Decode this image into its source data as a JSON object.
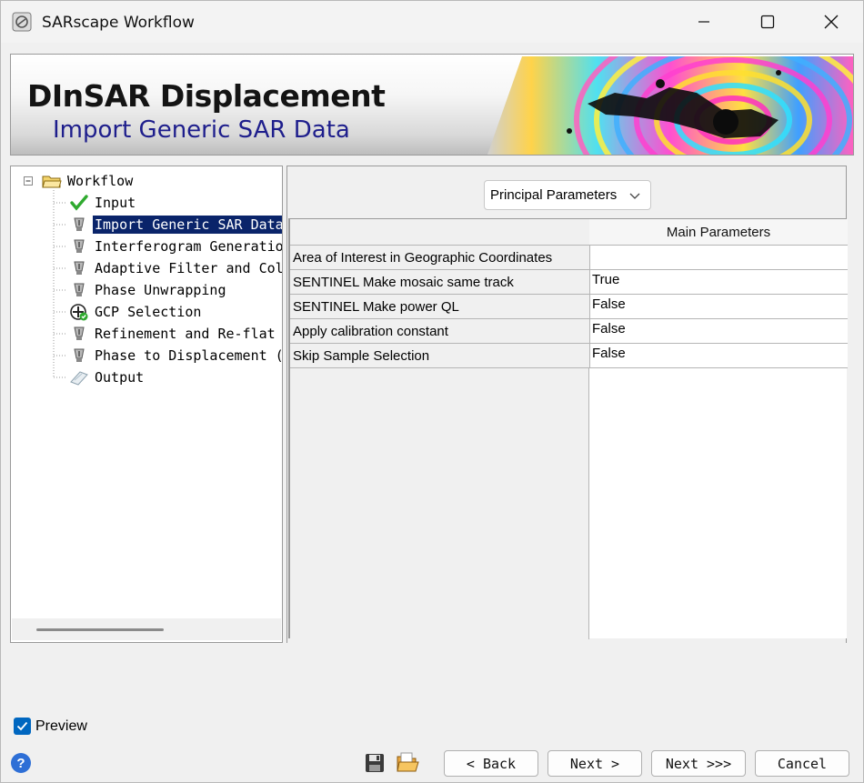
{
  "window": {
    "title": "SARscape Workflow"
  },
  "banner": {
    "title": "DInSAR Displacement",
    "subtitle": "Import Generic SAR Data"
  },
  "tree": {
    "root": "Workflow",
    "items": [
      {
        "label": "Input",
        "icon": "check-icon"
      },
      {
        "label": "Import Generic SAR Data",
        "icon": "tool-icon",
        "selected": true
      },
      {
        "label": "Interferogram Generation",
        "icon": "tool-icon"
      },
      {
        "label": "Adaptive Filter and Col",
        "icon": "tool-icon"
      },
      {
        "label": "Phase Unwrapping",
        "icon": "tool-icon"
      },
      {
        "label": "GCP Selection",
        "icon": "gcp-icon"
      },
      {
        "label": "Refinement and Re-flat",
        "icon": "tool-icon"
      },
      {
        "label": "Phase to Displacement (",
        "icon": "tool-icon"
      },
      {
        "label": "Output",
        "icon": "output-icon"
      }
    ]
  },
  "parameters": {
    "selector": "Principal Parameters",
    "column_header": "Main Parameters",
    "rows": [
      {
        "name": "Area of Interest in Geographic Coordinates",
        "value": ""
      },
      {
        "name": "SENTINEL Make mosaic same track",
        "value": "True"
      },
      {
        "name": "SENTINEL Make power QL",
        "value": "False"
      },
      {
        "name": "Apply calibration constant",
        "value": "False"
      },
      {
        "name": "Skip Sample Selection",
        "value": "False"
      }
    ]
  },
  "footer": {
    "preview_label": "Preview",
    "preview_checked": true,
    "back_label": "< Back",
    "next_label": "Next >",
    "next_end_label": "Next >>>",
    "cancel_label": "Cancel",
    "help_label": "?"
  },
  "colors": {
    "selection": "#0a246a",
    "subtitle": "#1e1e8c",
    "checkbox": "#0067c0"
  }
}
